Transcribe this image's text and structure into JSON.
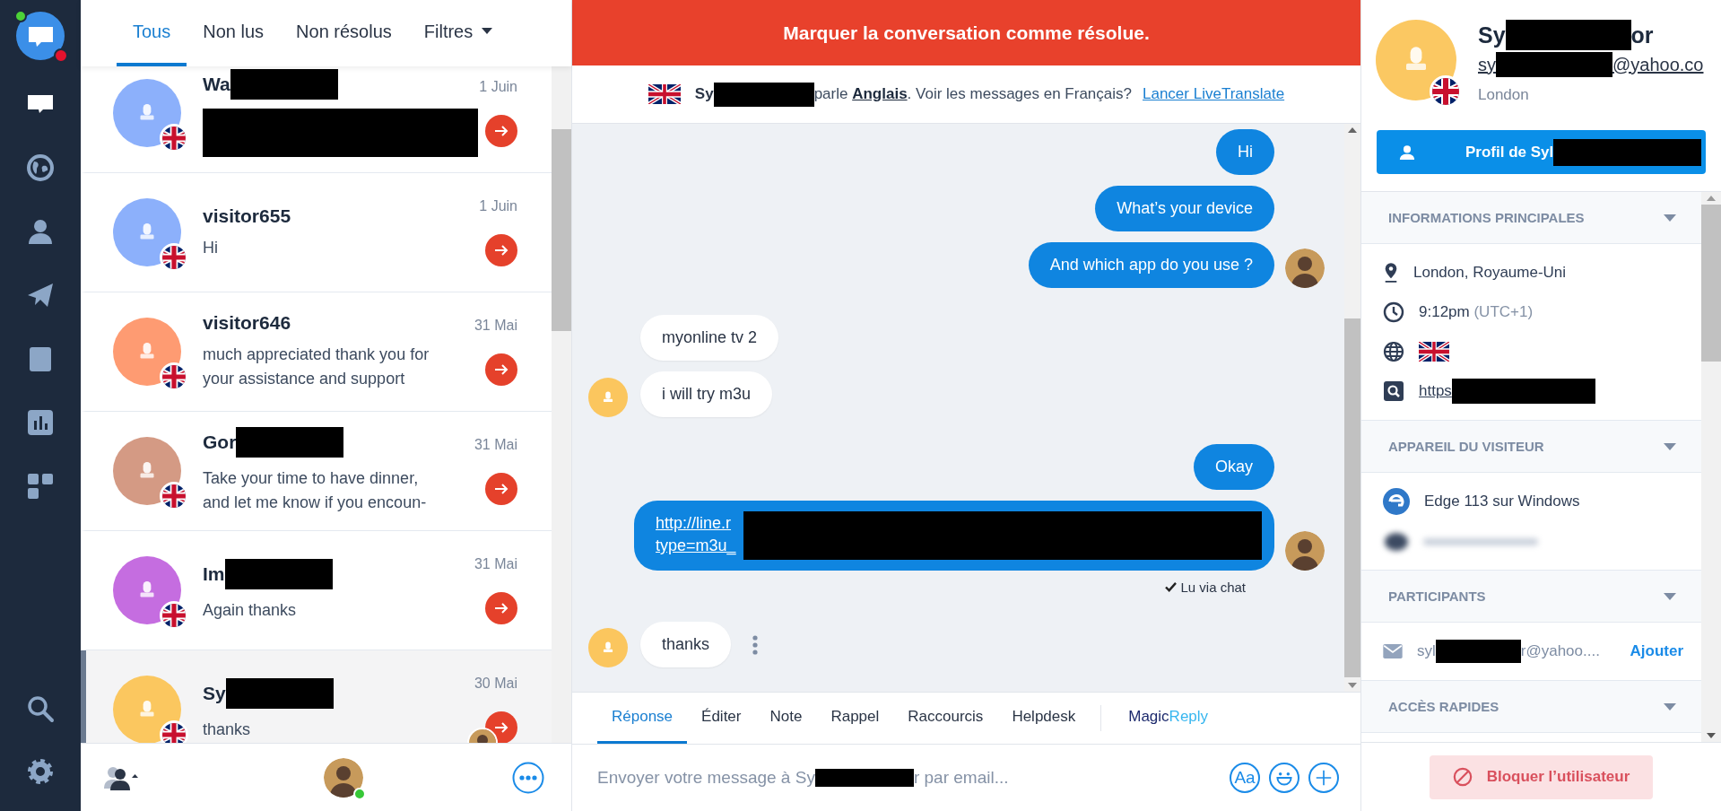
{
  "sidebar": {
    "items": [
      {
        "kind": "chat",
        "selected": true
      },
      {
        "kind": "globe",
        "selected": false
      },
      {
        "kind": "person",
        "selected": false
      },
      {
        "kind": "send",
        "selected": false
      },
      {
        "kind": "book",
        "selected": false
      },
      {
        "kind": "chart",
        "selected": false
      },
      {
        "kind": "apps",
        "selected": false
      }
    ],
    "bottom": [
      {
        "kind": "search"
      },
      {
        "kind": "settings"
      }
    ]
  },
  "list_tabs": [
    {
      "label": "Tous",
      "selected": true,
      "dropdown": false
    },
    {
      "label": "Non lus",
      "selected": false,
      "dropdown": false
    },
    {
      "label": "Non résolus",
      "selected": false,
      "dropdown": false
    },
    {
      "label": "Filtres",
      "selected": false,
      "dropdown": true
    }
  ],
  "conversations": [
    {
      "name": "Wa",
      "redacted": true,
      "preview_redacted": true,
      "date": "1 Juin",
      "color": "#8cb0fb",
      "selected": false,
      "agent_avatar": false
    },
    {
      "name": "visitor655",
      "redacted": false,
      "preview": [
        "Hi"
      ],
      "date": "1 Juin",
      "color": "#8cb0fb",
      "selected": false,
      "agent_avatar": false
    },
    {
      "name": "visitor646",
      "redacted": false,
      "preview": [
        "much appreciated thank you for",
        "your assistance and support"
      ],
      "date": "31 Mai",
      "color": "#fe9b72",
      "selected": false,
      "agent_avatar": false
    },
    {
      "name": "Gor",
      "redacted": true,
      "preview": [
        "Take your time to have dinner,",
        "and let me know if you encoun-"
      ],
      "date": "31 Mai",
      "color": "#d49a84",
      "selected": false,
      "agent_avatar": false
    },
    {
      "name": "Im",
      "redacted": true,
      "preview": [
        "Again thanks"
      ],
      "date": "31 Mai",
      "color": "#c56de0",
      "selected": false,
      "agent_avatar": false
    },
    {
      "name": "Sy",
      "redacted": true,
      "preview": [
        "thanks"
      ],
      "date": "30 Mai",
      "color": "#fbc75f",
      "selected": true,
      "agent_avatar": true
    }
  ],
  "list_footer": {
    "agent_online": true
  },
  "chat": {
    "banner": "Marquer la conversation comme résolue.",
    "translate": {
      "visitor": "Sy",
      "sentence": "parle **Anglais**. Voir les messages en Français?",
      "link": "Lancer LiveTranslate"
    },
    "messages": [
      {
        "from_agent": true,
        "kind": "text",
        "text": "Hi",
        "avatar": false
      },
      {
        "from_agent": true,
        "kind": "text",
        "text": "What’s your device",
        "avatar": false
      },
      {
        "from_agent": true,
        "kind": "text",
        "text": "And which app do you use ?",
        "avatar": true
      },
      {
        "from_agent": false,
        "kind": "text",
        "text": "myonline tv 2",
        "avatar": false
      },
      {
        "from_agent": false,
        "kind": "text",
        "text": "i will try m3u",
        "avatar": true
      },
      {
        "from_agent": true,
        "kind": "text",
        "text": "Okay",
        "avatar": false
      },
      {
        "from_agent": true,
        "kind": "link",
        "lines": [
          "http://line.r",
          "type=m3u_"
        ],
        "avatar": true,
        "receipt": "Lu via chat"
      },
      {
        "from_agent": false,
        "kind": "text",
        "text": "thanks",
        "avatar": true,
        "menu": true
      }
    ],
    "compose_tabs": [
      {
        "kind": "tab",
        "label": "Réponse",
        "selected": true
      },
      {
        "kind": "tab",
        "label": "Éditer",
        "selected": false
      },
      {
        "kind": "tab",
        "label": "Note",
        "selected": false
      },
      {
        "kind": "tab",
        "label": "Rappel",
        "selected": false
      },
      {
        "kind": "tab",
        "label": "Raccourcis",
        "selected": false
      },
      {
        "kind": "tab",
        "label": "Helpdesk",
        "selected": false
      },
      {
        "kind": "brand",
        "label": "Magic",
        "label_suffix": "Reply",
        "selected": false
      }
    ],
    "placeholder": [
      "Envoyer votre message à Sy",
      "r par email..."
    ],
    "tools": [
      {
        "kind": "format",
        "label": "Aa"
      },
      {
        "kind": "emoji"
      },
      {
        "kind": "add"
      }
    ]
  },
  "profile": {
    "name_start": "Sy",
    "name_end": "or",
    "email_start": "sy",
    "email_end": "@yahoo.co",
    "city": "London",
    "button_label": "Profil de Syl"
  },
  "sections": [
    {
      "title": "INFORMATIONS PRINCIPALES",
      "rows": [
        {
          "kind": "location",
          "text": "London, Royaume-Uni"
        },
        {
          "kind": "time",
          "text": "9:12pm",
          "note": "(UTC+1)"
        },
        {
          "kind": "language"
        },
        {
          "kind": "url",
          "text": "https"
        }
      ]
    },
    {
      "title": "APPAREIL DU VISITEUR",
      "rows": [
        {
          "kind": "browser",
          "text": "Edge 113 sur Windows"
        },
        {
          "kind": "blurred"
        }
      ]
    },
    {
      "title": "PARTICIPANTS",
      "rows": [
        {
          "kind": "participant",
          "text": "syl",
          "text_end": "r@yahoo....",
          "action": "Ajouter"
        }
      ]
    },
    {
      "title": "ACCÈS RAPIDES"
    }
  ],
  "block_button": {
    "label": "Bloquer l’utilisateur",
    "disabled": true
  }
}
